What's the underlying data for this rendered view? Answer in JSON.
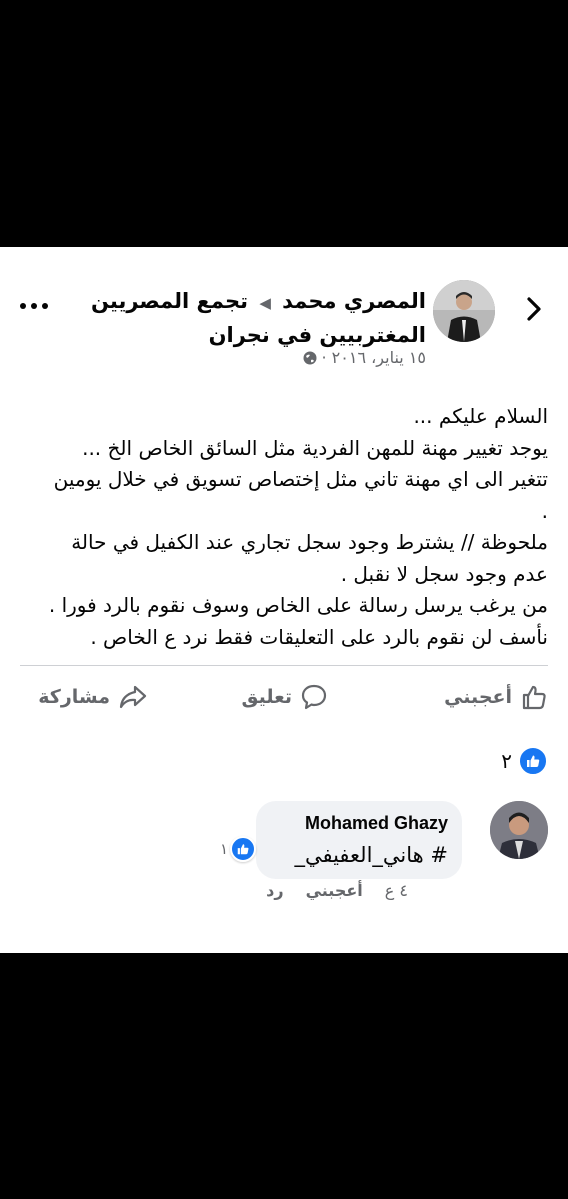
{
  "post": {
    "author": "المصري محمد",
    "arrow": "◀",
    "group": "تجمع المصريين المغتربيين في نجران",
    "date": "١٥ يناير، ٢٠١٦ ·",
    "text": "السلام عليكم ...\nيوجد تغيير مهنة للمهن الفردية مثل السائق الخاص الخ ...\nتتغير الى اي مهنة تاني مثل إختصاص تسويق في خلال يومين\n.\nملحوظة // يشترط وجود سجل تجاري عند الكفيل في حالة\nعدم وجود سجل لا نقبل .\nمن يرغب يرسل رسالة على الخاص وسوف نقوم بالرد فورا .\nنأسف لن نقوم بالرد على التعليقات فقط نرد  ع الخاص ."
  },
  "actions": {
    "like": "أعجبني",
    "comment": "تعليق",
    "share": "مشاركة"
  },
  "reactions": {
    "count": "٢"
  },
  "comment": {
    "name": "Mohamed Ghazy",
    "text": "# هاني_العفيفي_",
    "reaction_count": "١",
    "time": "٤ ع",
    "like": "أعجبني",
    "reply": "رد"
  },
  "colors": {
    "accent": "#1877f2",
    "secondary_text": "#65676b",
    "bubble": "#f0f2f5"
  },
  "icons": [
    "back-icon",
    "more-icon",
    "globe-icon",
    "like-icon",
    "comment-icon",
    "share-icon"
  ]
}
